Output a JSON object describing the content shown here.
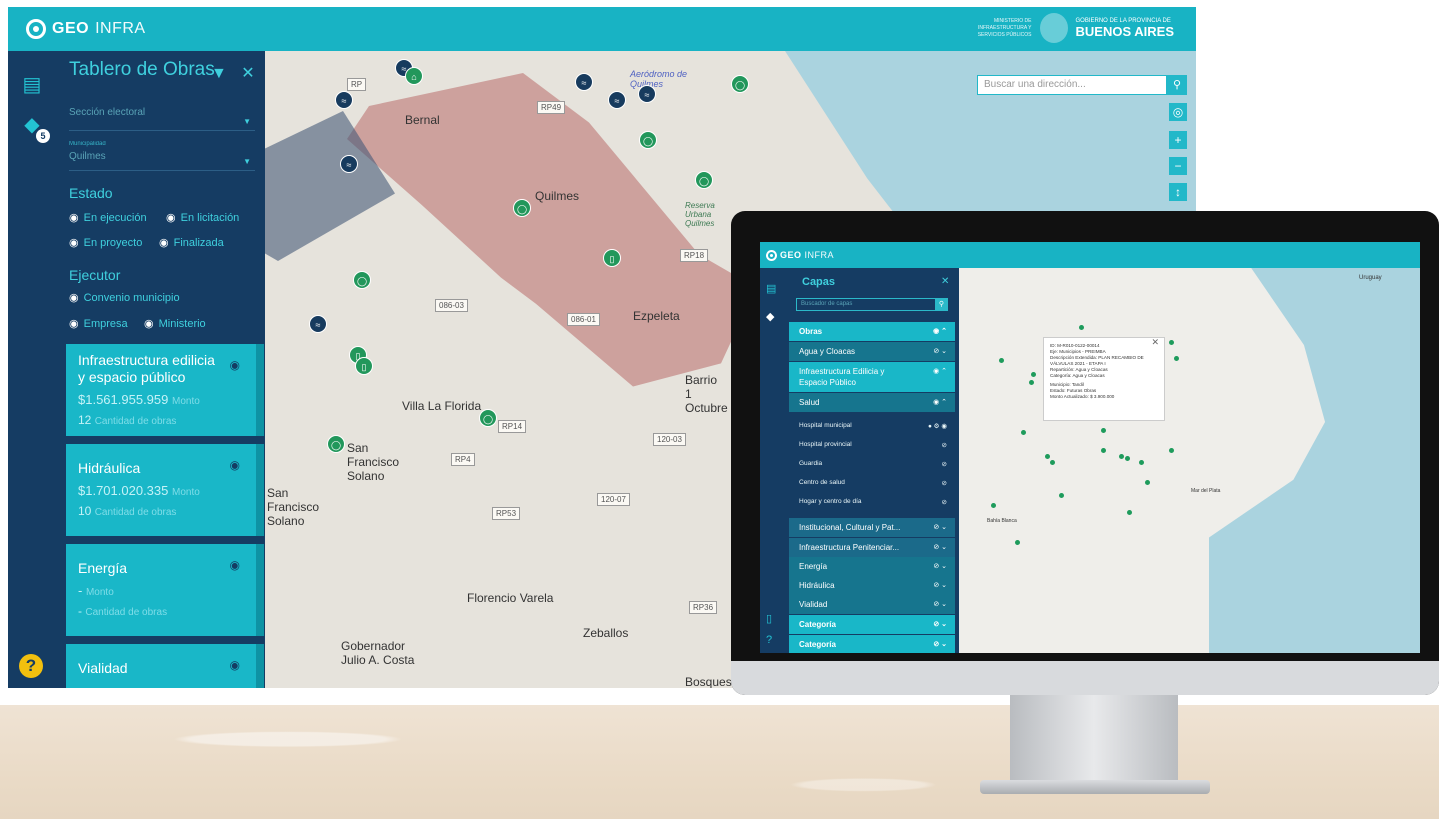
{
  "big_app": {
    "logo_bold": "GEO",
    "logo_light": "INFRA",
    "gov": {
      "small_text": "MINISTERIO DE INFRAESTRUCTURA Y SERVICIOS PÚBLICOS",
      "line1": "GOBIERNO DE LA PROVINCIA DE",
      "line2": "BUENOS AIRES"
    },
    "rail_badge": "5",
    "rail_help": "?",
    "panel": {
      "title": "Tablero de Obras",
      "filters": [
        {
          "label": "",
          "value": "Sección electoral"
        },
        {
          "label": "Municipalidad",
          "value": "Quilmes"
        }
      ],
      "estado": {
        "heading": "Estado",
        "options": [
          "En ejecución",
          "En licitación",
          "En proyecto",
          "Finalizada"
        ]
      },
      "ejecutor": {
        "heading": "Ejecutor",
        "options": [
          "Convenio municipio",
          "Empresa",
          "Ministerio"
        ]
      },
      "cards": [
        {
          "title": "Infraestructura edilicia y espacio público",
          "amount": "$1.561.955.959",
          "amount_label": "Monto",
          "count": "12",
          "count_label": "Cantidad de obras"
        },
        {
          "title": "Hidráulica",
          "amount": "$1.701.020.335",
          "amount_label": "Monto",
          "count": "10",
          "count_label": "Cantidad de obras"
        },
        {
          "title": "Energía",
          "amount": "-",
          "amount_label": "Monto",
          "count": "-",
          "count_label": "Cantidad de obras"
        },
        {
          "title": "Vialidad",
          "amount": "",
          "amount_label": "",
          "count": "",
          "count_label": ""
        }
      ]
    },
    "map": {
      "search_placeholder": "Buscar una dirección...",
      "labels": [
        "Bernal",
        "Quilmes",
        "Ezpeleta",
        "Villa La Florida",
        "San Francisco Solano",
        "San Francisco Solano",
        "Florencio Varela",
        "Gobernador Julio A. Costa",
        "Zeballos",
        "Bosques",
        "Barrio 1 Octubre",
        "Aeródromo de Quilmes",
        "Reserva Urbana Quilmes"
      ],
      "tags": [
        "RP49",
        "RP18",
        "086-03",
        "086-01",
        "RP14",
        "RP4",
        "120-03",
        "120-07",
        "RP53",
        "RP36",
        "RP"
      ]
    }
  },
  "monitor_app": {
    "logo_bold": "GEO",
    "logo_light": "INFRA",
    "panel": {
      "title": "Capas",
      "search_placeholder": "Buscador de capas",
      "rows": [
        {
          "label": "Obras",
          "style": "cyan bold"
        },
        {
          "label": "Agua y Cloacas",
          "style": "teal"
        },
        {
          "label": "Infraestructura Edilicia y Espacio Público",
          "style": "cyan tall"
        },
        {
          "label": "Salud",
          "style": "teal"
        }
      ],
      "sub_items": [
        "Hospital municipal",
        "Hospital provincial",
        "Guardia",
        "Centro de salud",
        "Hogar y centro de día"
      ],
      "rows2": [
        {
          "label": "Institucional, Cultural y Pat...",
          "style": "mid"
        },
        {
          "label": "Infraestructura Penitenciar...",
          "style": "mid"
        },
        {
          "label": "Energía",
          "style": "teal"
        },
        {
          "label": "Hidráulica",
          "style": "teal"
        },
        {
          "label": "Vialidad",
          "style": "teal"
        },
        {
          "label": "Categoría",
          "style": "cyan bold"
        },
        {
          "label": "Categoría",
          "style": "cyan bold"
        }
      ]
    },
    "popup": {
      "id": "ID: M-R010-0122-00014",
      "eje": "Eje: Municipios - PREIMBA",
      "descripcion": "Descripción Extendida: PLAN RECAMBIO DE VÁLVULAS 2021 - ETAPA I",
      "reparticion": "Repartición: Agua y Cloacas",
      "categoria": "Categoría: Agua y Cloacas",
      "municipio": "Municipio: Tandil",
      "estado": "Estado: Futuras Obras",
      "monto": "Monto Actualizado: $ 3.900.000"
    },
    "map_labels": [
      "Uruguay",
      "Mar del Plata",
      "Bahía Blanca"
    ]
  },
  "colors": {
    "header": "#18b3c4",
    "panel": "#153c63",
    "accent": "#3fd0de",
    "card": "#19b7c8",
    "pin_green": "#22975b",
    "pin_navy": "#173b5e",
    "help": "#f2c00f"
  }
}
